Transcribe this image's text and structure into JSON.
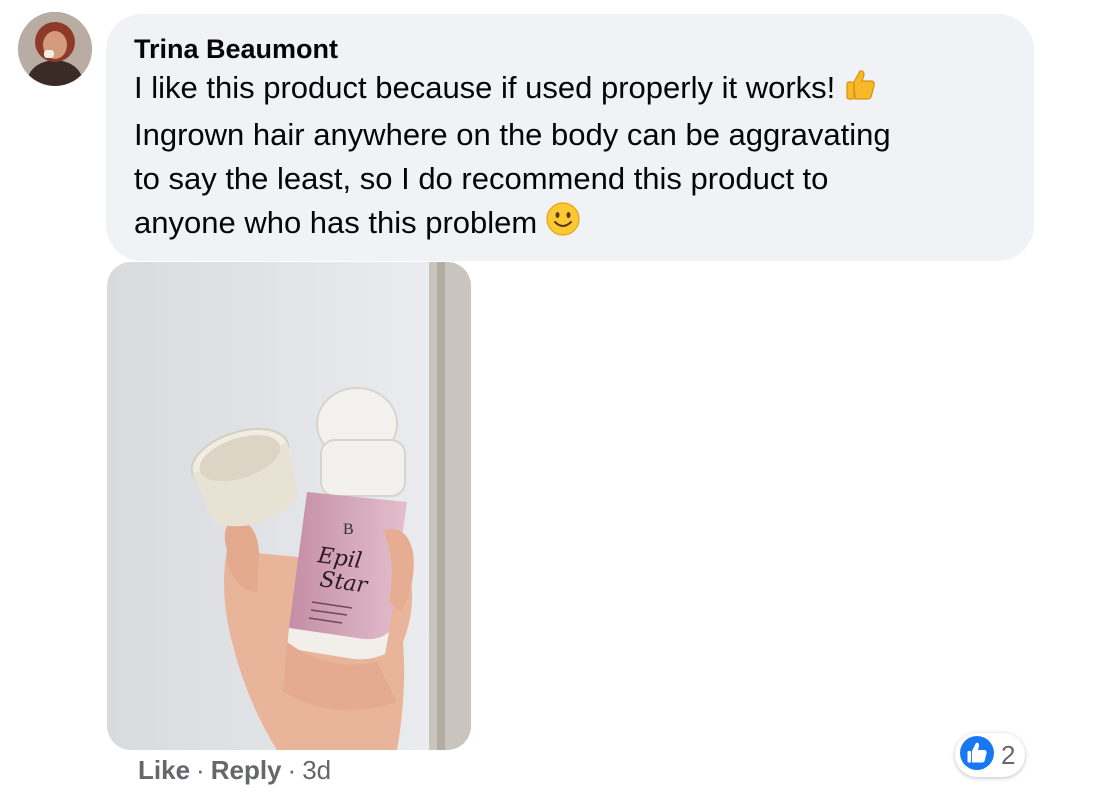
{
  "comment": {
    "author": "Trina Beaumont",
    "lines": [
      "I like this product because if used properly it works!",
      "Ingrown hair anywhere on the body can be aggravating",
      "to say the least, so I do recommend this product to",
      "anyone who has this problem"
    ],
    "emojis": [
      "thumbs-up",
      "slightly-smiling-face"
    ],
    "photo": {
      "product_brand_mark": "B",
      "product_name_line1": "Epil",
      "product_name_line2": "Star"
    }
  },
  "actions": {
    "like_label": "Like",
    "separator": "·",
    "reply_label": "Reply",
    "timestamp": "3d"
  },
  "reactions": {
    "type": "like",
    "count": "2"
  },
  "colors": {
    "bubble_bg": "#f0f2f5",
    "meta_text": "#65676b",
    "like_blue": "#1877f2"
  }
}
